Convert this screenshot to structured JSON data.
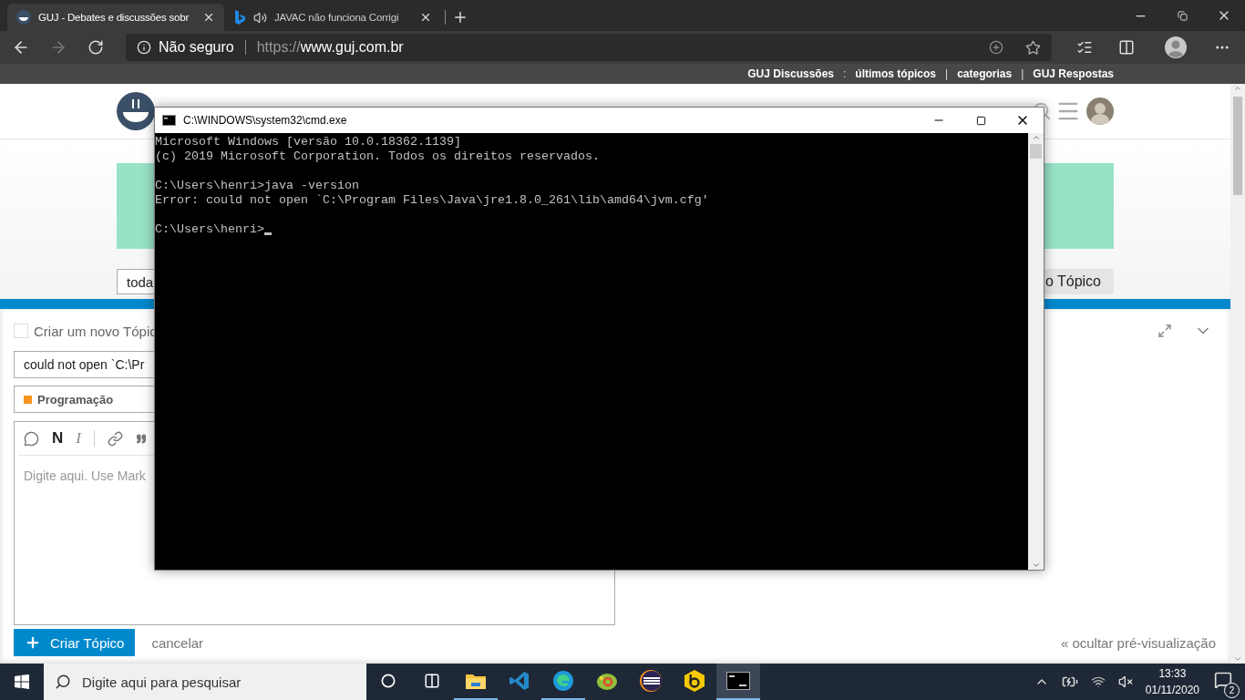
{
  "browser": {
    "tabs": [
      {
        "title": "GUJ - Debates e discussões sobr",
        "selected": true,
        "audio": false
      },
      {
        "title": "JAVAC não funciona Corrigi",
        "selected": false,
        "audio": true
      }
    ],
    "security_label": "Não seguro",
    "url_scheme": "https://",
    "url_host": "www.guj.com.br"
  },
  "site_nav": [
    {
      "kind": "link",
      "text": "GUJ Discussões"
    },
    {
      "kind": "separator",
      "text": ":"
    },
    {
      "kind": "link",
      "text": "últimos tópicos"
    },
    {
      "kind": "separator",
      "text": "|"
    },
    {
      "kind": "link",
      "text": "categorias"
    },
    {
      "kind": "separator",
      "text": "|"
    },
    {
      "kind": "link",
      "text": "GUJ Respostas"
    }
  ],
  "page": {
    "filter_select": "toda",
    "new_topic_button": "o Tópico"
  },
  "composer": {
    "title": "Criar um novo Tópic",
    "title_value": "could not open `C:\\Pr",
    "category": {
      "name": "Programação",
      "color": "#f7941d"
    },
    "editor_tools": [
      {
        "kind": "comment"
      },
      {
        "kind": "bold",
        "label": "N"
      },
      {
        "kind": "italic",
        "label": "I"
      },
      {
        "kind": "divider"
      },
      {
        "kind": "link"
      },
      {
        "kind": "quote"
      }
    ],
    "placeholder": "Digite aqui. Use Mark",
    "submit": "Criar Tópico",
    "cancel": "cancelar",
    "hide_preview": "« ocultar pré-visualização"
  },
  "cmd": {
    "title": "C:\\WINDOWS\\system32\\cmd.exe",
    "blocks": [
      [
        "Microsoft Windows [versão 10.0.18362.1139]",
        "(c) 2019 Microsoft Corporation. Todos os direitos reservados."
      ],
      [
        "C:\\Users\\henri>java -version",
        "Error: could not open `C:\\Program Files\\Java\\jre1.8.0_261\\lib\\amd64\\jvm.cfg'"
      ],
      [
        "C:\\Users\\henri>"
      ]
    ]
  },
  "taskbar": {
    "search_placeholder": "Digite aqui para pesquisar",
    "apps": [
      {
        "kind": "explorer",
        "running": true,
        "active": false
      },
      {
        "kind": "vscode",
        "running": false,
        "active": false
      },
      {
        "kind": "edge",
        "running": true,
        "active": false
      },
      {
        "kind": "chameleon",
        "running": false,
        "active": false
      },
      {
        "kind": "eclipse",
        "running": false,
        "active": false
      },
      {
        "kind": "hexagon",
        "running": false,
        "active": false
      },
      {
        "kind": "terminal",
        "running": true,
        "active": true
      }
    ],
    "time": "13:33",
    "date": "01/11/2020",
    "notifications": "2"
  }
}
